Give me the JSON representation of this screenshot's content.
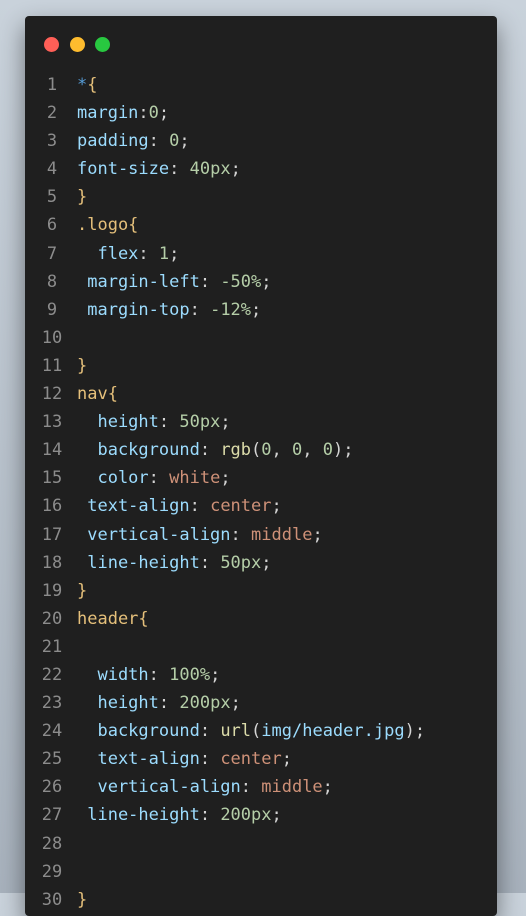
{
  "window": {
    "controls": [
      "close",
      "minimize",
      "maximize"
    ],
    "control_colors": [
      "#ff5f57",
      "#febc2e",
      "#28c840"
    ]
  },
  "code": {
    "lines": [
      {
        "n": "1",
        "tokens": [
          {
            "t": "*",
            "c": "star"
          },
          {
            "t": "{",
            "c": "sel"
          }
        ]
      },
      {
        "n": "2",
        "tokens": [
          {
            "t": "margin",
            "c": "prop"
          },
          {
            "t": ":",
            "c": "punc"
          },
          {
            "t": "0",
            "c": "num"
          },
          {
            "t": ";",
            "c": "punc"
          }
        ]
      },
      {
        "n": "3",
        "tokens": [
          {
            "t": "padding",
            "c": "prop"
          },
          {
            "t": ": ",
            "c": "punc"
          },
          {
            "t": "0",
            "c": "num"
          },
          {
            "t": ";",
            "c": "punc"
          }
        ]
      },
      {
        "n": "4",
        "tokens": [
          {
            "t": "font-size",
            "c": "prop"
          },
          {
            "t": ": ",
            "c": "punc"
          },
          {
            "t": "40px",
            "c": "num"
          },
          {
            "t": ";",
            "c": "punc"
          }
        ]
      },
      {
        "n": "5",
        "tokens": [
          {
            "t": "}",
            "c": "sel"
          }
        ]
      },
      {
        "n": "6",
        "tokens": [
          {
            "t": ".logo{",
            "c": "sel"
          }
        ]
      },
      {
        "n": "7",
        "tokens": [
          {
            "t": "  flex",
            "c": "prop"
          },
          {
            "t": ": ",
            "c": "punc"
          },
          {
            "t": "1",
            "c": "num"
          },
          {
            "t": ";",
            "c": "punc"
          }
        ]
      },
      {
        "n": "8",
        "tokens": [
          {
            "t": " margin-left",
            "c": "prop"
          },
          {
            "t": ": ",
            "c": "punc"
          },
          {
            "t": "-50%",
            "c": "num"
          },
          {
            "t": ";",
            "c": "punc"
          }
        ]
      },
      {
        "n": "9",
        "tokens": [
          {
            "t": " margin-top",
            "c": "prop"
          },
          {
            "t": ": ",
            "c": "punc"
          },
          {
            "t": "-12%",
            "c": "num"
          },
          {
            "t": ";",
            "c": "punc"
          }
        ]
      },
      {
        "n": "10",
        "tokens": []
      },
      {
        "n": "11",
        "tokens": [
          {
            "t": "}",
            "c": "sel"
          }
        ]
      },
      {
        "n": "12",
        "tokens": [
          {
            "t": "nav{",
            "c": "sel"
          }
        ]
      },
      {
        "n": "13",
        "tokens": [
          {
            "t": "  height",
            "c": "prop"
          },
          {
            "t": ": ",
            "c": "punc"
          },
          {
            "t": "50px",
            "c": "num"
          },
          {
            "t": ";",
            "c": "punc"
          }
        ]
      },
      {
        "n": "14",
        "tokens": [
          {
            "t": "  background",
            "c": "prop"
          },
          {
            "t": ": ",
            "c": "punc"
          },
          {
            "t": "rgb",
            "c": "fn"
          },
          {
            "t": "(",
            "c": "punc"
          },
          {
            "t": "0",
            "c": "num"
          },
          {
            "t": ", ",
            "c": "punc"
          },
          {
            "t": "0",
            "c": "num"
          },
          {
            "t": ", ",
            "c": "punc"
          },
          {
            "t": "0",
            "c": "num"
          },
          {
            "t": ");",
            "c": "punc"
          }
        ]
      },
      {
        "n": "15",
        "tokens": [
          {
            "t": "  color",
            "c": "prop"
          },
          {
            "t": ": ",
            "c": "punc"
          },
          {
            "t": "white",
            "c": "kw"
          },
          {
            "t": ";",
            "c": "punc"
          }
        ]
      },
      {
        "n": "16",
        "tokens": [
          {
            "t": " text-align",
            "c": "prop"
          },
          {
            "t": ": ",
            "c": "punc"
          },
          {
            "t": "center",
            "c": "kw"
          },
          {
            "t": ";",
            "c": "punc"
          }
        ]
      },
      {
        "n": "17",
        "tokens": [
          {
            "t": " vertical-align",
            "c": "prop"
          },
          {
            "t": ": ",
            "c": "punc"
          },
          {
            "t": "middle",
            "c": "kw"
          },
          {
            "t": ";",
            "c": "punc"
          }
        ]
      },
      {
        "n": "18",
        "tokens": [
          {
            "t": " line-height",
            "c": "prop"
          },
          {
            "t": ": ",
            "c": "punc"
          },
          {
            "t": "50px",
            "c": "num"
          },
          {
            "t": ";",
            "c": "punc"
          }
        ]
      },
      {
        "n": "19",
        "tokens": [
          {
            "t": "}",
            "c": "sel"
          }
        ]
      },
      {
        "n": "20",
        "tokens": [
          {
            "t": "header{",
            "c": "sel"
          }
        ]
      },
      {
        "n": "21",
        "tokens": []
      },
      {
        "n": "22",
        "tokens": [
          {
            "t": "  width",
            "c": "prop"
          },
          {
            "t": ": ",
            "c": "punc"
          },
          {
            "t": "100%",
            "c": "num"
          },
          {
            "t": ";",
            "c": "punc"
          }
        ]
      },
      {
        "n": "23",
        "tokens": [
          {
            "t": "  height",
            "c": "prop"
          },
          {
            "t": ": ",
            "c": "punc"
          },
          {
            "t": "200px",
            "c": "num"
          },
          {
            "t": ";",
            "c": "punc"
          }
        ]
      },
      {
        "n": "24",
        "tokens": [
          {
            "t": "  background",
            "c": "prop"
          },
          {
            "t": ": ",
            "c": "punc"
          },
          {
            "t": "url",
            "c": "fn"
          },
          {
            "t": "(",
            "c": "punc"
          },
          {
            "t": "img/header.jpg",
            "c": "prop"
          },
          {
            "t": ");",
            "c": "punc"
          }
        ]
      },
      {
        "n": "25",
        "tokens": [
          {
            "t": "  text-align",
            "c": "prop"
          },
          {
            "t": ": ",
            "c": "punc"
          },
          {
            "t": "center",
            "c": "kw"
          },
          {
            "t": ";",
            "c": "punc"
          }
        ]
      },
      {
        "n": "26",
        "tokens": [
          {
            "t": "  vertical-align",
            "c": "prop"
          },
          {
            "t": ": ",
            "c": "punc"
          },
          {
            "t": "middle",
            "c": "kw"
          },
          {
            "t": ";",
            "c": "punc"
          }
        ]
      },
      {
        "n": "27",
        "tokens": [
          {
            "t": " line-height",
            "c": "prop"
          },
          {
            "t": ": ",
            "c": "punc"
          },
          {
            "t": "200px",
            "c": "num"
          },
          {
            "t": ";",
            "c": "punc"
          }
        ]
      },
      {
        "n": "28",
        "tokens": []
      },
      {
        "n": "29",
        "tokens": []
      },
      {
        "n": "30",
        "tokens": [
          {
            "t": "}",
            "c": "sel"
          }
        ]
      }
    ]
  }
}
